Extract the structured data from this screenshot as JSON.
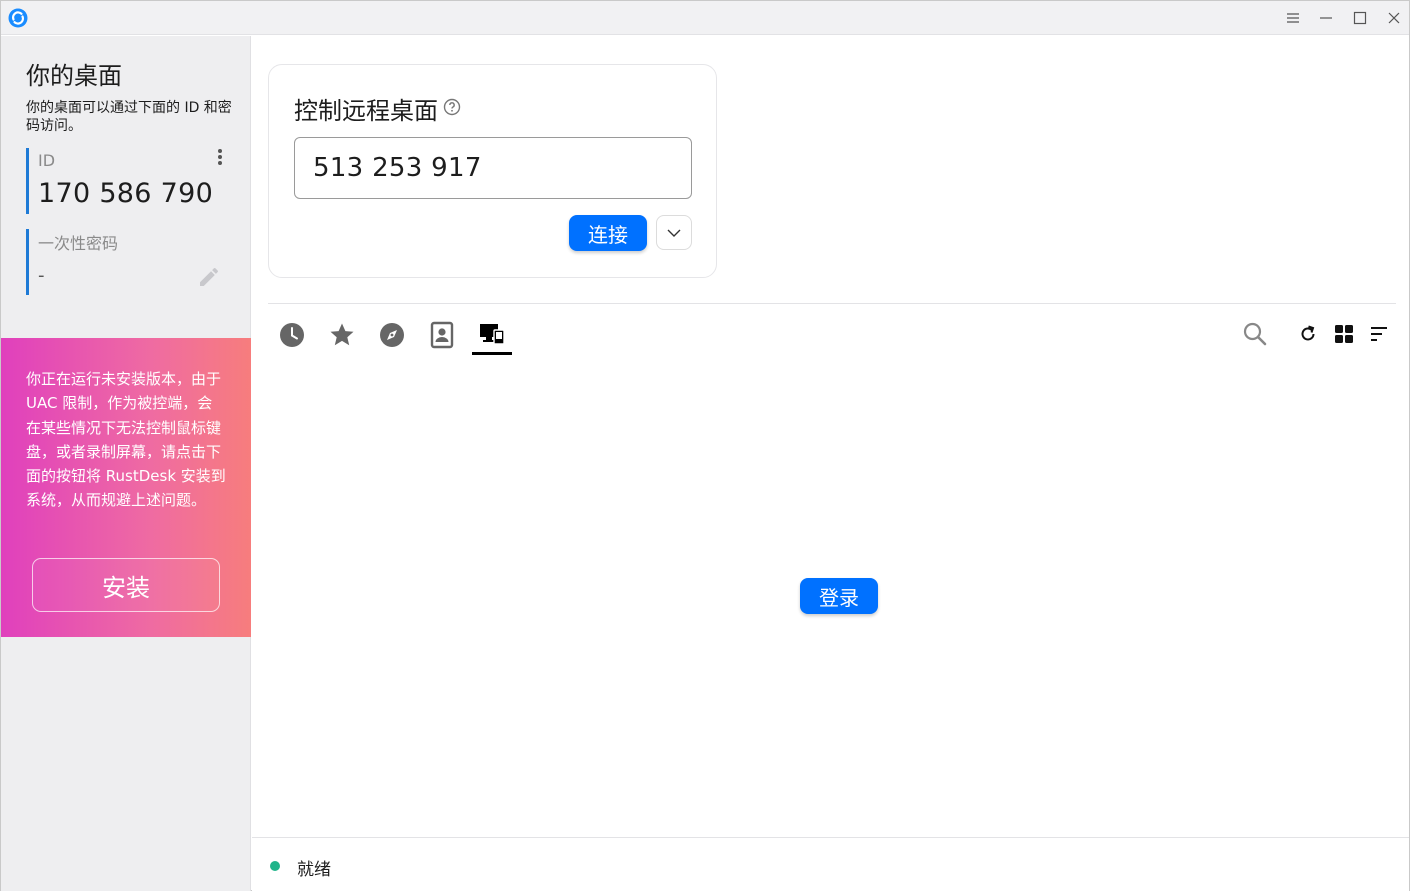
{
  "sidebar": {
    "title": "你的桌面",
    "description": "你的桌面可以通过下面的 ID 和密码访问。",
    "id_label": "ID",
    "id_value": "170 586 790",
    "password_label": "一次性密码",
    "password_value": "-",
    "warning": "你正在运行未安装版本，由于 UAC 限制，作为被控端，会在某些情况下无法控制鼠标键盘，或者录制屏幕，请点击下面的按钮将 RustDesk 安装到系统，从而规避上述问题。",
    "install_label": "安装"
  },
  "connect": {
    "title": "控制远程桌面",
    "remote_id": "513 253 917",
    "connect_label": "连接"
  },
  "tabs": [
    {
      "icon": "history-icon"
    },
    {
      "icon": "star-icon"
    },
    {
      "icon": "compass-icon"
    },
    {
      "icon": "address-book-icon"
    },
    {
      "icon": "devices-icon",
      "active": true
    }
  ],
  "main": {
    "login_label": "登录"
  },
  "status": {
    "text": "就绪",
    "color": "#20b48a"
  },
  "colors": {
    "accent": "#0071ff",
    "id_bar": "#1e7ad6"
  }
}
